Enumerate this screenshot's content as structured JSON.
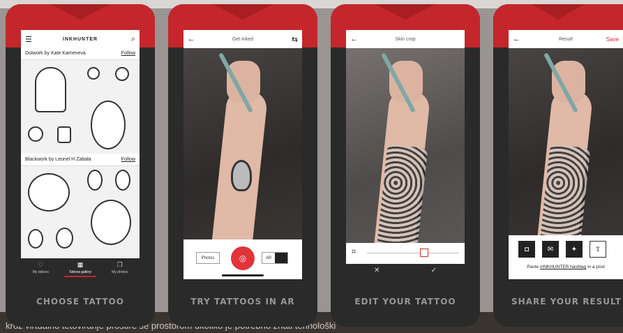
{
  "background_text": "kroz virtualno tetoviranje prostire se prostorom ukoliko je potrebno znati tehnološki",
  "cards": [
    {
      "caption": "CHOOSE TATTOO",
      "header": {
        "brand": "INKHUNTER"
      },
      "sections": [
        {
          "title": "Dotwork by Kate Kameneva",
          "follow": "Follow"
        },
        {
          "title": "Blackwork by Leonel H Zabala",
          "follow": "Follow"
        }
      ],
      "tabs": [
        {
          "label": "My tattoos",
          "icon": "heart-icon"
        },
        {
          "label": "Tattoos gallery",
          "icon": "grid-icon"
        },
        {
          "label": "My photos",
          "icon": "photos-icon"
        }
      ]
    },
    {
      "caption": "TRY TATTOOS IN AR",
      "header": {
        "title": "Get inked"
      },
      "controls": {
        "photos": "Photos",
        "ar": "AR"
      }
    },
    {
      "caption": "EDIT YOUR TATTOO",
      "header": {
        "title": "Skin crop"
      }
    },
    {
      "caption": "SHARE YOUR RESULT",
      "header": {
        "title": "Result",
        "save": "Save"
      },
      "share_prefix": "Paste ",
      "share_hashtag": "#INKHUNTER hashtag",
      "share_suffix": " in a post"
    }
  ]
}
